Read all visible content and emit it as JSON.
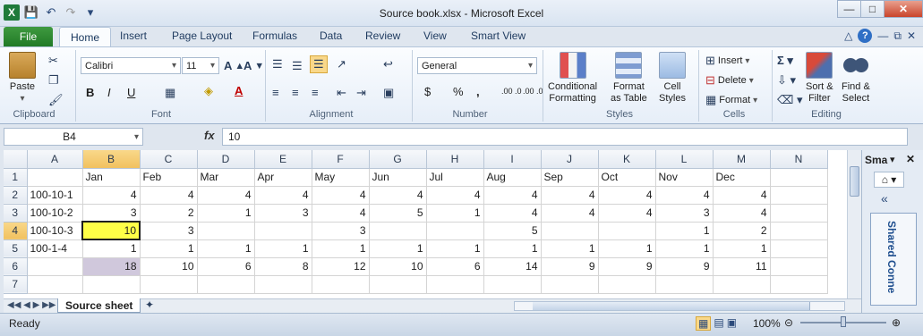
{
  "window": {
    "title": "Source book.xlsx - Microsoft Excel"
  },
  "tabs": {
    "file": "File",
    "home": "Home",
    "insert": "Insert",
    "page_layout": "Page Layout",
    "formulas": "Formulas",
    "data": "Data",
    "review": "Review",
    "view": "View",
    "smart_view": "Smart View"
  },
  "ribbon": {
    "clipboard": {
      "paste": "Paste",
      "label": "Clipboard"
    },
    "font": {
      "name": "Calibri",
      "size": "11",
      "label": "Font",
      "bold": "B",
      "italic": "I",
      "underline": "U"
    },
    "alignment": {
      "label": "Alignment"
    },
    "number": {
      "format": "General",
      "label": "Number",
      "currency": "$",
      "percent": "%",
      "comma": ",",
      "inc_dec": ".00 .0",
      "dec_dec": ".00 .0"
    },
    "styles": {
      "label": "Styles",
      "conditional": "Conditional",
      "conditional2": "Formatting",
      "format_table": "Format",
      "format_table2": "as Table",
      "cell_styles": "Cell",
      "cell_styles2": "Styles"
    },
    "cells": {
      "label": "Cells",
      "insert": "Insert",
      "delete": "Delete",
      "format": "Format"
    },
    "editing": {
      "label": "Editing",
      "sort": "Sort &",
      "sort2": "Filter",
      "find": "Find &",
      "find2": "Select"
    }
  },
  "formula_bar": {
    "name_box": "B4",
    "fx": "fx",
    "value": "10"
  },
  "grid": {
    "columns": [
      "A",
      "B",
      "C",
      "D",
      "E",
      "F",
      "G",
      "H",
      "I",
      "J",
      "K",
      "L",
      "M",
      "N"
    ],
    "rows": [
      {
        "n": "1",
        "cells": [
          "",
          "Jan",
          "Feb",
          "Mar",
          "Apr",
          "May",
          "Jun",
          "Jul",
          "Aug",
          "Sep",
          "Oct",
          "Nov",
          "Dec",
          ""
        ]
      },
      {
        "n": "2",
        "cells": [
          "100-10-1",
          "4",
          "4",
          "4",
          "4",
          "4",
          "4",
          "4",
          "4",
          "4",
          "4",
          "4",
          "4",
          ""
        ]
      },
      {
        "n": "3",
        "cells": [
          "100-10-2",
          "3",
          "2",
          "1",
          "3",
          "4",
          "5",
          "1",
          "4",
          "4",
          "4",
          "3",
          "4",
          ""
        ]
      },
      {
        "n": "4",
        "cells": [
          "100-10-3",
          "10",
          "3",
          "",
          "",
          "3",
          "",
          "",
          "5",
          "",
          "",
          "1",
          "2",
          ""
        ]
      },
      {
        "n": "5",
        "cells": [
          "100-1-4",
          "1",
          "1",
          "1",
          "1",
          "1",
          "1",
          "1",
          "1",
          "1",
          "1",
          "1",
          "1",
          ""
        ]
      },
      {
        "n": "6",
        "cells": [
          "",
          "18",
          "10",
          "6",
          "8",
          "12",
          "10",
          "6",
          "14",
          "9",
          "9",
          "9",
          "11",
          ""
        ]
      },
      {
        "n": "7",
        "cells": [
          "",
          "",
          "",
          "",
          "",
          "",
          "",
          "",
          "",
          "",
          "",
          "",
          "",
          ""
        ]
      }
    ]
  },
  "sheet_tab": "Source sheet",
  "side_pane": {
    "title": "Sma",
    "vertical": "Shared Conne"
  },
  "status": {
    "ready": "Ready",
    "zoom": "100%"
  }
}
